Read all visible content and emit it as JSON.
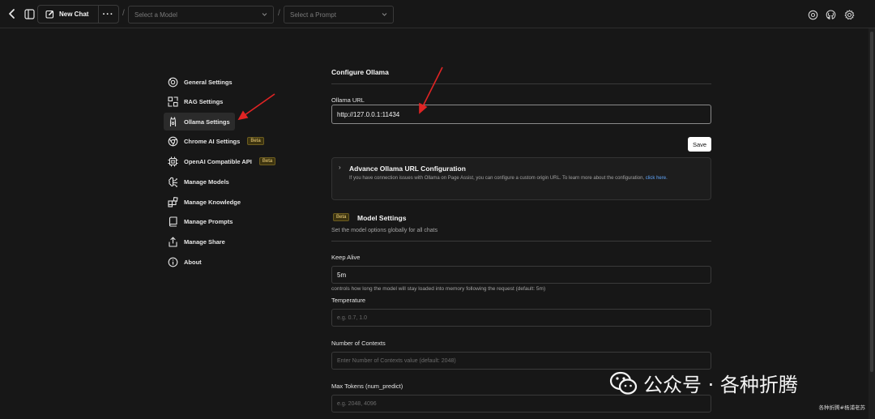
{
  "topbar": {
    "new_chat_label": "New Chat",
    "more_label": "···",
    "separator": "/",
    "model_select_placeholder": "Select a Model",
    "prompt_select_placeholder": "Select a Prompt",
    "icons": [
      "back-icon",
      "sidebar-toggle-icon",
      "new-chat-icon",
      "settings-icon",
      "github-icon",
      "gear-icon"
    ]
  },
  "sidebar": {
    "items": [
      {
        "label": "General Settings",
        "icon": "orbit-icon",
        "beta": ""
      },
      {
        "label": "RAG Settings",
        "icon": "scan-icon",
        "beta": ""
      },
      {
        "label": "Ollama Settings",
        "icon": "ollama-icon",
        "beta": "",
        "active": true
      },
      {
        "label": "Chrome AI Settings",
        "icon": "chrome-icon",
        "beta": "Beta"
      },
      {
        "label": "OpenAI Compatible API",
        "icon": "chip-icon",
        "beta": "Beta"
      },
      {
        "label": "Manage Models",
        "icon": "brain-icon",
        "beta": ""
      },
      {
        "label": "Manage Knowledge",
        "icon": "blocks-icon",
        "beta": ""
      },
      {
        "label": "Manage Prompts",
        "icon": "book-icon",
        "beta": ""
      },
      {
        "label": "Manage Share",
        "icon": "share-icon",
        "beta": ""
      },
      {
        "label": "About",
        "icon": "info-icon",
        "beta": ""
      }
    ]
  },
  "ollama": {
    "title": "Configure Ollama",
    "url_label": "Ollama URL",
    "url_value": "http://127.0.0.1:11434",
    "save_label": "Save",
    "advanced": {
      "title": "Advance Ollama URL Configuration",
      "description": "If you have connection issues with Ollama on Page Assist, you can configure a custom origin URL. To learn more about the configuration,",
      "link": "click here."
    }
  },
  "model_settings": {
    "beta": "Beta",
    "title": "Model Settings",
    "subtitle": "Set the model options globally for all chats",
    "keep_alive_label": "Keep Alive",
    "keep_alive_value": "5m",
    "keep_alive_help": "controls how long the model will stay loaded into memory following the request (default: 5m)",
    "temperature_label": "Temperature",
    "temperature_placeholder": "e.g. 0.7, 1.0",
    "contexts_label": "Number of Contexts",
    "contexts_placeholder": "Enter Number of Contexts value (default: 2048)",
    "max_tokens_label": "Max Tokens (num_predict)",
    "max_tokens_placeholder": "e.g. 2048, 4096"
  },
  "watermark": {
    "main": "公众号 · 各种折腾",
    "sub": "各种折腾#杨浦老苏"
  },
  "colors": {
    "background": "#171717",
    "annotation_arrow": "#e02424",
    "beta_badge": "#f1d17a",
    "link": "#60a5fa"
  }
}
